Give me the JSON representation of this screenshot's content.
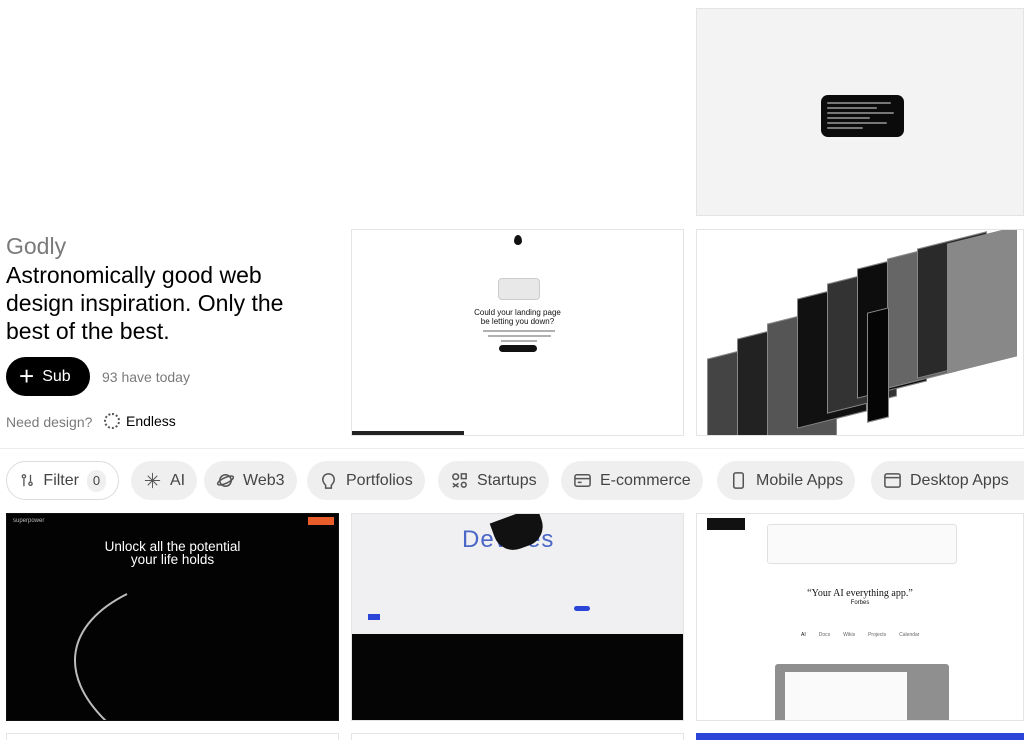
{
  "hero": {
    "brand": "Godly",
    "tagline": "Astronomically good web design inspiration. Only the best of the best.",
    "subscribe_label": "Sub",
    "today_count": "93 have today",
    "need_design": "Need design?",
    "endless_label": "Endless"
  },
  "cards_top": {
    "landing_title": "Could your landing page be letting you down?"
  },
  "filters": {
    "filter_label": "Filter",
    "filter_count": "0",
    "chips": [
      "AI",
      "Web3",
      "Portfolios",
      "Startups",
      "E-commerce",
      "Mobile Apps",
      "Desktop Apps"
    ]
  },
  "cards_bottom": {
    "superpower_brand": "superpower",
    "superpower_headline_1": "Unlock all the potential",
    "superpower_headline_2": "your life holds",
    "devices_word": "Devices",
    "notion_quote": "“Your AI everything app.”",
    "notion_source": "Forbes",
    "notion_tabs": [
      "AI",
      "Docs",
      "Wikis",
      "Projects",
      "Calendar"
    ]
  },
  "colors": {
    "accent_orange": "#e85d2a",
    "blue": "#2b45d8",
    "chip_bg": "#efefef"
  }
}
